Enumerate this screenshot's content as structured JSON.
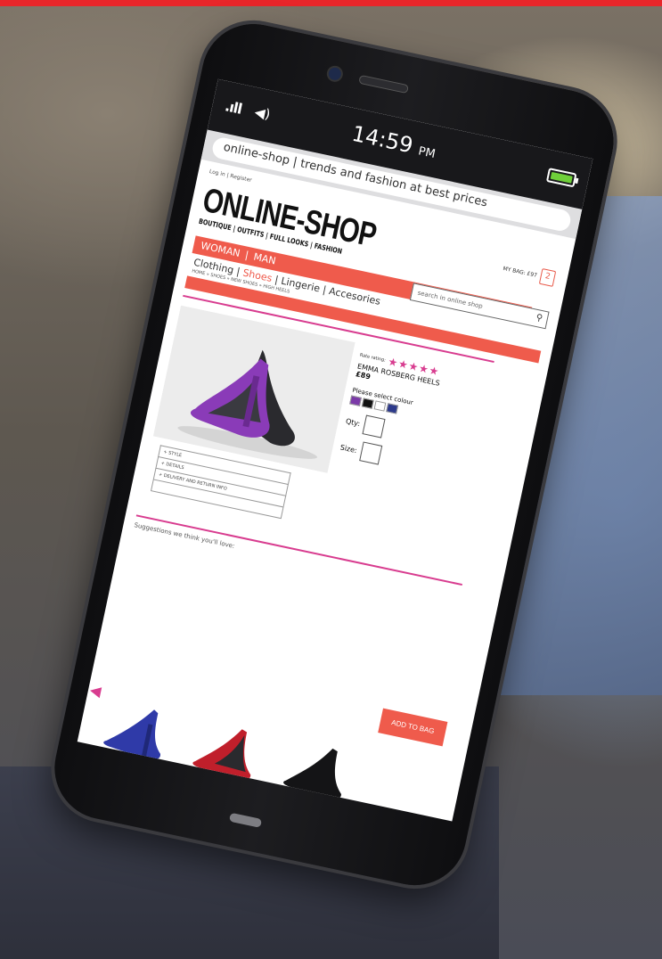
{
  "statusbar": {
    "time": "14:59",
    "ampm": "PM"
  },
  "browser": {
    "url": "online-shop | trends and fashion at best prices"
  },
  "header": {
    "auth_links": "Log in | Register",
    "logo": "ONLINE-SHOP",
    "tagline": "BOUTIQUE | OUTFITS | FULL LOOKS | FASHION",
    "bag_label": "MY BAG: £97",
    "bag_count": "2",
    "search_placeholder": "search in online shop"
  },
  "nav": {
    "genders": [
      "WOMAN",
      "MAN"
    ],
    "separator": "|",
    "categories": [
      "Clothing",
      "Shoes",
      "Lingerie",
      "Accesories"
    ],
    "active_category": "Shoes",
    "breadcrumb": "HOME » SHOES » NEW SHOES » HIGH HEELS"
  },
  "product": {
    "rating_label": "Rate rating:",
    "rating": 5,
    "stars": "★★★★★",
    "name": "EMMA ROSBERG HEELS",
    "price": "£89",
    "colour_label": "Please select colour",
    "colours": [
      "#7b3aa8",
      "#111111",
      "#ffffff",
      "#2d3a8c"
    ],
    "qty_label": "Qty:",
    "size_label": "Size:",
    "accordion": [
      "+ STYLE",
      "+ DETAILS",
      "+ DELIVERY AND RETURN INFO",
      ""
    ]
  },
  "suggestions": {
    "label": "Suggestions we think you'll love:",
    "add_to_bag": "ADD TO BAG"
  }
}
